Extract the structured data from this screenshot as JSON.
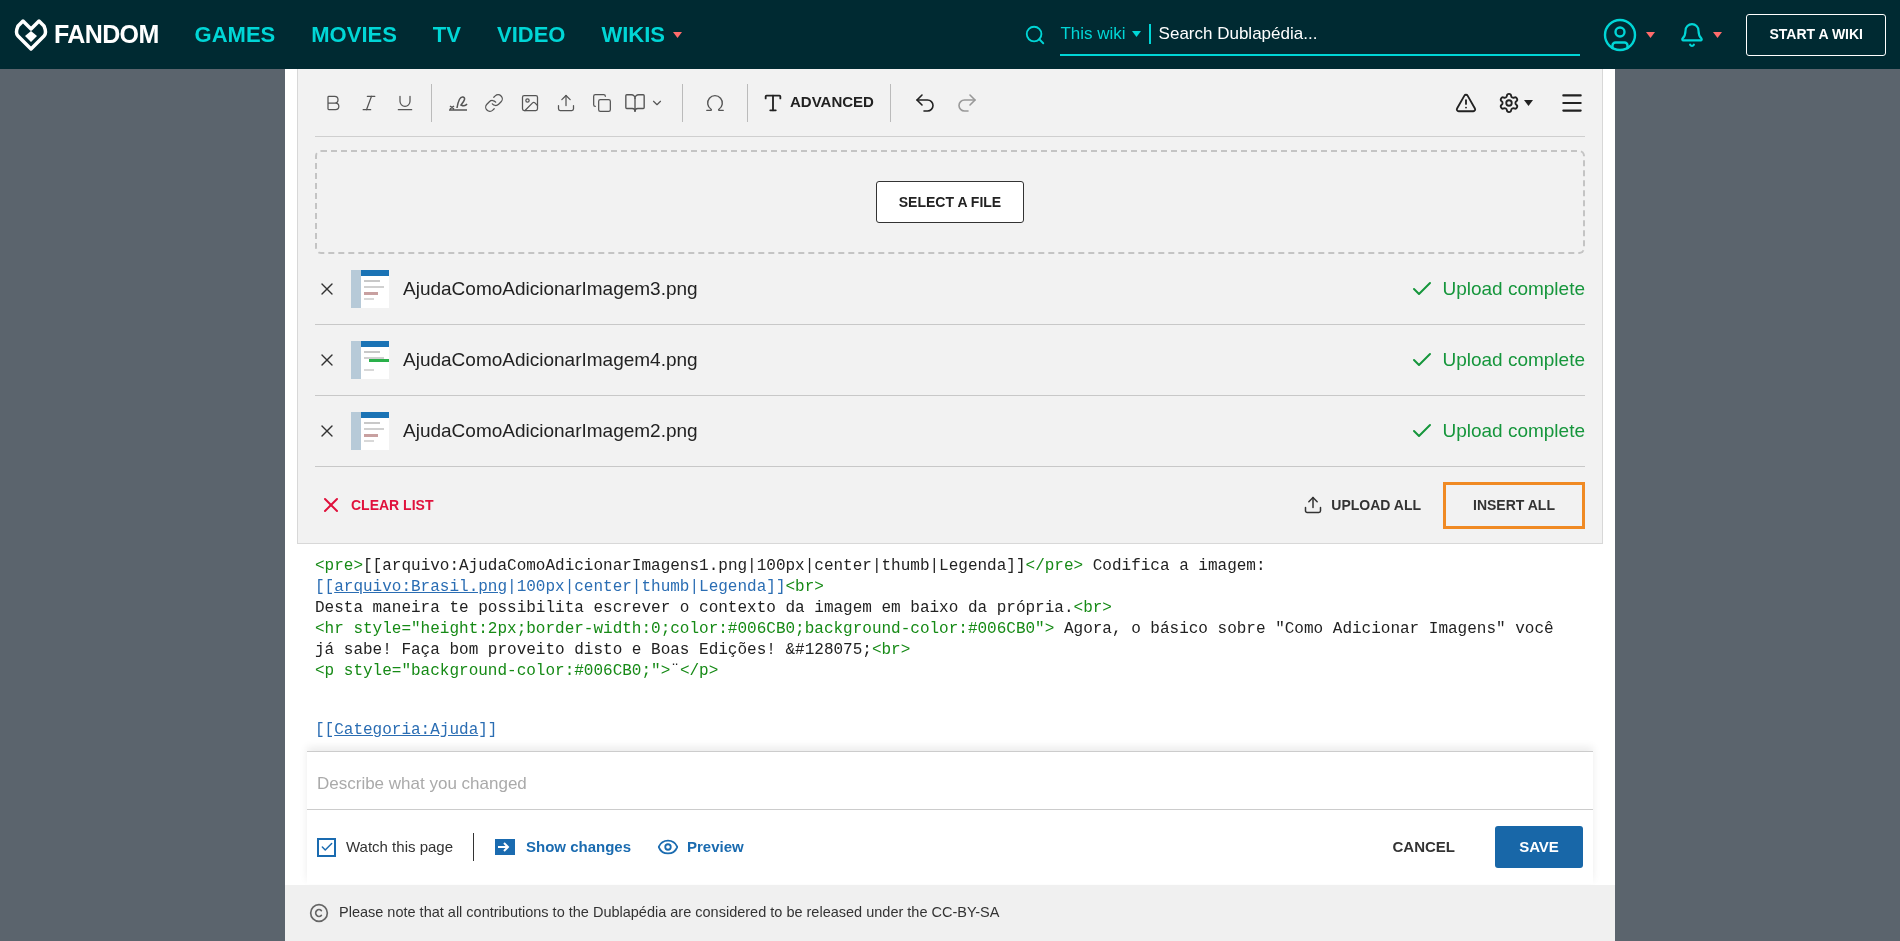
{
  "nav": {
    "logo": "FANDOM",
    "links": [
      {
        "label": "GAMES",
        "has_menu": false
      },
      {
        "label": "MOVIES",
        "has_menu": false
      },
      {
        "label": "TV",
        "has_menu": false
      },
      {
        "label": "VIDEO",
        "has_menu": false
      },
      {
        "label": "WIKIS",
        "has_menu": true
      }
    ],
    "search_scope": "This wiki",
    "search_placeholder": "Search Dublapédia...",
    "start_button": "START A WIKI"
  },
  "toolbar": {
    "advanced_label": "ADVANCED",
    "undo": {
      "disabled": false
    },
    "redo": {
      "disabled": true
    }
  },
  "upload": {
    "select_button": "SELECT A FILE",
    "files": [
      {
        "name": "AjudaComoAdicionarImagem3.png",
        "status": "Upload complete"
      },
      {
        "name": "AjudaComoAdicionarImagem4.png",
        "status": "Upload complete"
      },
      {
        "name": "AjudaComoAdicionarImagem2.png",
        "status": "Upload complete"
      }
    ],
    "clear_button": "CLEAR LIST",
    "upload_all_button": "UPLOAD ALL",
    "insert_all_button": {
      "label": "INSERT ALL",
      "focused": true
    }
  },
  "code": {
    "lines": [
      [
        {
          "kind": "tag",
          "text": "<pre>"
        },
        {
          "kind": "text",
          "text": "[[arquivo:AjudaComoAdicionarImagens1.png|100px|center|thumb|Legenda]]"
        },
        {
          "kind": "tag",
          "text": "</pre>"
        },
        {
          "kind": "text",
          "text": " Codifica a imagem:"
        }
      ],
      [
        {
          "kind": "link",
          "text": "[["
        },
        {
          "kind": "target",
          "text": "arquivo:Brasil.png"
        },
        {
          "kind": "link",
          "text": "|100px|center|thumb|Legenda]]"
        },
        {
          "kind": "tag",
          "text": "<br>"
        }
      ],
      [
        {
          "kind": "text",
          "text": "Desta maneira te possibilita escrever o contexto da imagem em baixo da própria."
        },
        {
          "kind": "tag",
          "text": "<br>"
        }
      ],
      [
        {
          "kind": "tag",
          "text": "<hr style=\"height:2px;border-width:0;color:#006CB0;background-color:#006CB0\">"
        },
        {
          "kind": "text",
          "text": " Agora, o básico sobre \"Como Adicionar Imagens\" você"
        }
      ],
      [
        {
          "kind": "text",
          "text": "já sabe! Faça bom proveito disto e Boas Edições! &#128075;"
        },
        {
          "kind": "tag",
          "text": "<br>"
        }
      ],
      [
        {
          "kind": "tag",
          "text": "<p style=\"background-color:#006CB0;\">"
        },
        {
          "kind": "text",
          "text": "¨"
        },
        {
          "kind": "tag",
          "text": "</p>"
        }
      ]
    ],
    "end_lines": [
      [
        {
          "kind": "link",
          "text": "[["
        },
        {
          "kind": "target",
          "text": "Categoria:Ajuda"
        },
        {
          "kind": "link",
          "text": "]]"
        }
      ]
    ]
  },
  "summary": {
    "placeholder": "Describe what you changed"
  },
  "actions": {
    "watch": {
      "label": "Watch this page",
      "checked": true
    },
    "show_changes": "Show changes",
    "preview": "Preview",
    "cancel": "CANCEL",
    "save": "SAVE"
  },
  "footer": {
    "notice": "Please note that all contributions to the Dublapédia are considered to be released under the CC-BY-SA"
  }
}
